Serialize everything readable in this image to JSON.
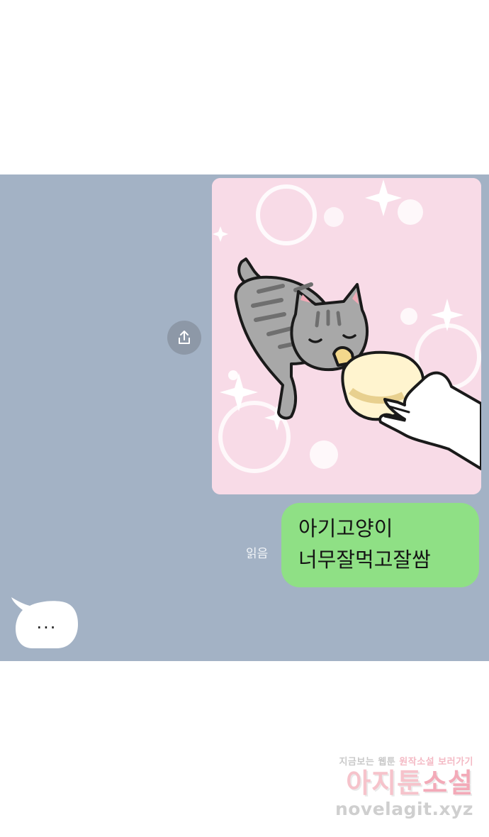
{
  "chat": {
    "photo_icon": "cat-feeding-bottle-illustration",
    "share_icon": "share-icon",
    "read_status": "읽음",
    "message_lines": [
      "아기고양이",
      "너무잘먹고잘쌈"
    ],
    "typing_indicator": "...",
    "colors": {
      "background": "#a3b2c5",
      "bubble": "#8fe085",
      "photo_bg": "#f8dbe7"
    }
  },
  "watermark": {
    "line1_part1": "지금보는 웹툰",
    "line1_part2": "원작소설 보러가기",
    "brand_part1": "아지툰",
    "brand_part2": "소설",
    "url": "novelagit.xyz"
  }
}
